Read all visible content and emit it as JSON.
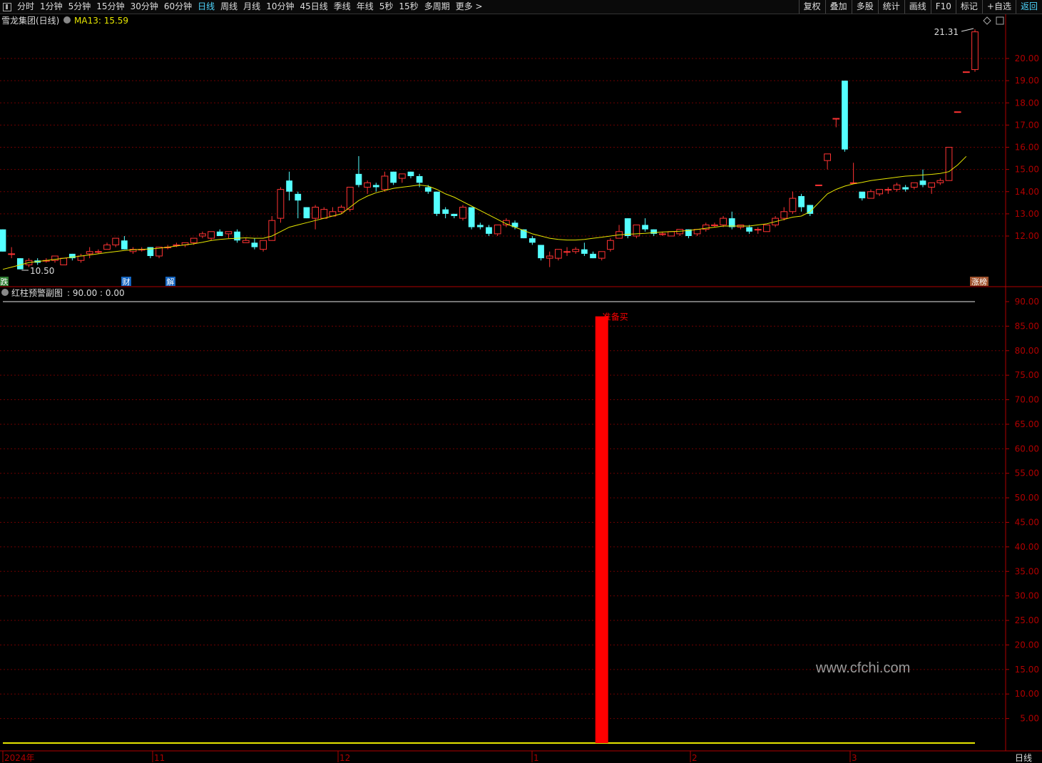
{
  "toolbar": {
    "periods": [
      "分时",
      "1分钟",
      "5分钟",
      "15分钟",
      "30分钟",
      "60分钟",
      "日线",
      "周线",
      "月线",
      "10分钟",
      "45日线",
      "季线",
      "年线",
      "5秒",
      "15秒",
      "多周期",
      "更多 >"
    ],
    "active_period": "日线",
    "right_buttons": [
      "复权",
      "叠加",
      "多股",
      "统计",
      "画线",
      "F10",
      "标记",
      "+自选",
      "返回"
    ]
  },
  "main_panel": {
    "stock_title": "雪龙集团(日线)",
    "ma_label": "MA13: 15.59",
    "high_marker": "21.31",
    "low_marker": "10.50",
    "y_ticks": [
      "20.00",
      "19.00",
      "18.00",
      "17.00",
      "16.00",
      "15.00",
      "14.00",
      "13.00",
      "12.00"
    ],
    "event_badges": [
      {
        "label": "跌",
        "color": "#2e7d32"
      },
      {
        "label": "财",
        "color": "#1565c0"
      },
      {
        "label": "解",
        "color": "#1565c0"
      },
      {
        "label": "涨榜",
        "color": "#a0522d"
      }
    ]
  },
  "sub_panel": {
    "title": "红柱预警副图",
    "values": ": 90.00 : 0.00",
    "signal_label": "准备买",
    "y_ticks": [
      "90.00",
      "85.00",
      "80.00",
      "75.00",
      "70.00",
      "65.00",
      "60.00",
      "55.00",
      "50.00",
      "45.00",
      "40.00",
      "35.00",
      "30.00",
      "25.00",
      "20.00",
      "15.00",
      "10.00",
      "5.00"
    ]
  },
  "x_axis": {
    "labels": [
      "2024年",
      "11",
      "12",
      "1",
      "2",
      "3"
    ],
    "period_label": "日线"
  },
  "watermark": "www.cfchi.com",
  "colors": {
    "up": "#ff3333",
    "down": "#54ffff",
    "ma": "#e6e600",
    "grid": "#6e0000",
    "axis": "#b00000",
    "signal_bar": "#ff0000",
    "accent": "#4fd7ff"
  },
  "chart_data": {
    "type": "candlestick",
    "ylim": [
      10.0,
      21.5
    ],
    "candles": [
      {
        "o": 12.3,
        "c": 11.3,
        "h": 12.3,
        "l": 11.3
      },
      {
        "o": 11.2,
        "c": 11.2,
        "h": 11.5,
        "l": 11.0
      },
      {
        "o": 11.0,
        "c": 10.5,
        "h": 11.0,
        "l": 10.5
      },
      {
        "o": 10.7,
        "c": 10.9,
        "h": 11.0,
        "l": 10.6
      },
      {
        "o": 10.9,
        "c": 10.8,
        "h": 11.0,
        "l": 10.7
      },
      {
        "o": 10.9,
        "c": 10.9,
        "h": 11.0,
        "l": 10.8
      },
      {
        "o": 10.9,
        "c": 11.1,
        "h": 11.1,
        "l": 10.8
      },
      {
        "o": 10.7,
        "c": 11.0,
        "h": 11.0,
        "l": 10.7
      },
      {
        "o": 11.2,
        "c": 11.0,
        "h": 11.2,
        "l": 10.9
      },
      {
        "o": 10.9,
        "c": 11.1,
        "h": 11.2,
        "l": 10.8
      },
      {
        "o": 11.2,
        "c": 11.3,
        "h": 11.5,
        "l": 11.0
      },
      {
        "o": 11.3,
        "c": 11.3,
        "h": 11.4,
        "l": 11.2
      },
      {
        "o": 11.4,
        "c": 11.6,
        "h": 11.7,
        "l": 11.4
      },
      {
        "o": 11.6,
        "c": 11.9,
        "h": 11.9,
        "l": 11.5
      },
      {
        "o": 11.8,
        "c": 11.4,
        "h": 12.0,
        "l": 11.4
      },
      {
        "o": 11.3,
        "c": 11.4,
        "h": 11.5,
        "l": 11.2
      },
      {
        "o": 11.4,
        "c": 11.4,
        "h": 11.5,
        "l": 11.3
      },
      {
        "o": 11.5,
        "c": 11.1,
        "h": 11.5,
        "l": 11.0
      },
      {
        "o": 11.1,
        "c": 11.5,
        "h": 11.5,
        "l": 11.0
      },
      {
        "o": 11.5,
        "c": 11.5,
        "h": 11.6,
        "l": 11.4
      },
      {
        "o": 11.6,
        "c": 11.6,
        "h": 11.7,
        "l": 11.5
      },
      {
        "o": 11.6,
        "c": 11.7,
        "h": 11.7,
        "l": 11.5
      },
      {
        "o": 11.7,
        "c": 11.9,
        "h": 11.9,
        "l": 11.6
      },
      {
        "o": 12.0,
        "c": 12.1,
        "h": 12.2,
        "l": 11.9
      },
      {
        "o": 11.9,
        "c": 12.2,
        "h": 12.2,
        "l": 11.8
      },
      {
        "o": 12.2,
        "c": 12.0,
        "h": 12.3,
        "l": 12.0
      },
      {
        "o": 12.1,
        "c": 12.2,
        "h": 12.2,
        "l": 11.9
      },
      {
        "o": 12.2,
        "c": 11.8,
        "h": 12.3,
        "l": 11.7
      },
      {
        "o": 11.7,
        "c": 11.8,
        "h": 11.9,
        "l": 11.7
      },
      {
        "o": 11.7,
        "c": 11.5,
        "h": 11.9,
        "l": 11.4
      },
      {
        "o": 11.4,
        "c": 11.8,
        "h": 11.8,
        "l": 11.3
      },
      {
        "o": 11.8,
        "c": 12.7,
        "h": 12.9,
        "l": 11.8
      },
      {
        "o": 12.8,
        "c": 14.1,
        "h": 14.2,
        "l": 12.6
      },
      {
        "o": 14.5,
        "c": 14.0,
        "h": 14.9,
        "l": 13.6
      },
      {
        "o": 13.9,
        "c": 13.6,
        "h": 14.0,
        "l": 12.8
      },
      {
        "o": 13.3,
        "c": 12.8,
        "h": 13.3,
        "l": 12.8
      },
      {
        "o": 12.8,
        "c": 13.3,
        "h": 13.4,
        "l": 12.3
      },
      {
        "o": 12.8,
        "c": 13.2,
        "h": 13.3,
        "l": 12.8
      },
      {
        "o": 12.9,
        "c": 13.1,
        "h": 13.3,
        "l": 12.9
      },
      {
        "o": 13.1,
        "c": 13.3,
        "h": 13.4,
        "l": 13.0
      },
      {
        "o": 13.2,
        "c": 14.2,
        "h": 14.2,
        "l": 13.1
      },
      {
        "o": 14.8,
        "c": 14.3,
        "h": 15.6,
        "l": 14.2
      },
      {
        "o": 14.2,
        "c": 14.4,
        "h": 14.5,
        "l": 13.9
      },
      {
        "o": 14.3,
        "c": 14.2,
        "h": 14.4,
        "l": 14.0
      },
      {
        "o": 14.1,
        "c": 14.7,
        "h": 14.9,
        "l": 14.0
      },
      {
        "o": 14.9,
        "c": 14.4,
        "h": 14.9,
        "l": 14.3
      },
      {
        "o": 14.6,
        "c": 14.8,
        "h": 14.8,
        "l": 14.4
      },
      {
        "o": 14.9,
        "c": 14.7,
        "h": 14.9,
        "l": 14.6
      },
      {
        "o": 14.7,
        "c": 14.4,
        "h": 14.8,
        "l": 14.2
      },
      {
        "o": 14.2,
        "c": 14.0,
        "h": 14.3,
        "l": 13.9
      },
      {
        "o": 14.0,
        "c": 13.0,
        "h": 14.0,
        "l": 12.9
      },
      {
        "o": 13.2,
        "c": 13.0,
        "h": 13.3,
        "l": 12.8
      },
      {
        "o": 13.0,
        "c": 12.9,
        "h": 13.0,
        "l": 12.8
      },
      {
        "o": 12.8,
        "c": 13.3,
        "h": 13.4,
        "l": 12.7
      },
      {
        "o": 13.3,
        "c": 12.4,
        "h": 13.3,
        "l": 12.3
      },
      {
        "o": 12.5,
        "c": 12.4,
        "h": 12.6,
        "l": 12.3
      },
      {
        "o": 12.4,
        "c": 12.1,
        "h": 12.5,
        "l": 12.0
      },
      {
        "o": 12.1,
        "c": 12.5,
        "h": 12.5,
        "l": 12.0
      },
      {
        "o": 12.5,
        "c": 12.7,
        "h": 12.8,
        "l": 12.4
      },
      {
        "o": 12.6,
        "c": 12.4,
        "h": 12.7,
        "l": 12.3
      },
      {
        "o": 12.3,
        "c": 11.9,
        "h": 12.3,
        "l": 11.9
      },
      {
        "o": 11.9,
        "c": 11.7,
        "h": 12.0,
        "l": 11.6
      },
      {
        "o": 11.6,
        "c": 11.0,
        "h": 11.6,
        "l": 10.9
      },
      {
        "o": 11.0,
        "c": 11.1,
        "h": 11.3,
        "l": 10.6
      },
      {
        "o": 11.0,
        "c": 11.4,
        "h": 11.4,
        "l": 10.9
      },
      {
        "o": 11.3,
        "c": 11.3,
        "h": 11.5,
        "l": 11.1
      },
      {
        "o": 11.3,
        "c": 11.4,
        "h": 11.5,
        "l": 11.2
      },
      {
        "o": 11.4,
        "c": 11.2,
        "h": 11.7,
        "l": 11.1
      },
      {
        "o": 11.2,
        "c": 11.0,
        "h": 11.3,
        "l": 11.0
      },
      {
        "o": 11.0,
        "c": 11.3,
        "h": 11.3,
        "l": 10.9
      },
      {
        "o": 11.4,
        "c": 11.8,
        "h": 11.9,
        "l": 11.3
      },
      {
        "o": 11.9,
        "c": 12.2,
        "h": 12.5,
        "l": 11.9
      },
      {
        "o": 12.8,
        "c": 12.0,
        "h": 12.8,
        "l": 11.9
      },
      {
        "o": 12.0,
        "c": 12.5,
        "h": 12.5,
        "l": 11.9
      },
      {
        "o": 12.5,
        "c": 12.3,
        "h": 12.8,
        "l": 12.2
      },
      {
        "o": 12.3,
        "c": 12.1,
        "h": 12.3,
        "l": 12.0
      },
      {
        "o": 12.1,
        "c": 12.1,
        "h": 12.2,
        "l": 12.0
      },
      {
        "o": 12.0,
        "c": 12.2,
        "h": 12.2,
        "l": 12.0
      },
      {
        "o": 12.1,
        "c": 12.3,
        "h": 12.3,
        "l": 12.0
      },
      {
        "o": 12.3,
        "c": 12.0,
        "h": 12.3,
        "l": 11.9
      },
      {
        "o": 12.1,
        "c": 12.3,
        "h": 12.3,
        "l": 12.0
      },
      {
        "o": 12.3,
        "c": 12.5,
        "h": 12.6,
        "l": 12.2
      },
      {
        "o": 12.5,
        "c": 12.5,
        "h": 12.6,
        "l": 12.4
      },
      {
        "o": 12.5,
        "c": 12.8,
        "h": 12.9,
        "l": 12.4
      },
      {
        "o": 12.8,
        "c": 12.4,
        "h": 13.1,
        "l": 12.3
      },
      {
        "o": 12.4,
        "c": 12.5,
        "h": 12.5,
        "l": 12.3
      },
      {
        "o": 12.4,
        "c": 12.2,
        "h": 12.5,
        "l": 12.1
      },
      {
        "o": 12.3,
        "c": 12.3,
        "h": 12.4,
        "l": 12.1
      },
      {
        "o": 12.2,
        "c": 12.5,
        "h": 12.5,
        "l": 12.2
      },
      {
        "o": 12.5,
        "c": 12.8,
        "h": 12.9,
        "l": 12.4
      },
      {
        "o": 12.8,
        "c": 13.1,
        "h": 13.3,
        "l": 12.7
      },
      {
        "o": 13.1,
        "c": 13.7,
        "h": 14.0,
        "l": 13.0
      },
      {
        "o": 13.8,
        "c": 13.3,
        "h": 13.9,
        "l": 13.1
      },
      {
        "o": 13.4,
        "c": 13.0,
        "h": 13.4,
        "l": 12.9
      },
      {
        "o": 14.3,
        "c": 14.3,
        "h": 14.3,
        "l": 14.3
      },
      {
        "o": 15.4,
        "c": 15.7,
        "h": 15.7,
        "l": 15.0
      },
      {
        "o": 17.3,
        "c": 17.3,
        "h": 17.3,
        "l": 16.9
      },
      {
        "o": 19.0,
        "c": 15.9,
        "h": 19.0,
        "l": 15.8
      },
      {
        "o": 14.4,
        "c": 14.4,
        "h": 15.3,
        "l": 14.4
      },
      {
        "o": 14.0,
        "c": 13.7,
        "h": 14.0,
        "l": 13.6
      },
      {
        "o": 13.7,
        "c": 14.0,
        "h": 14.1,
        "l": 13.7
      },
      {
        "o": 13.9,
        "c": 14.1,
        "h": 14.1,
        "l": 13.8
      },
      {
        "o": 14.1,
        "c": 14.1,
        "h": 14.2,
        "l": 13.9
      },
      {
        "o": 14.1,
        "c": 14.3,
        "h": 14.4,
        "l": 14.0
      },
      {
        "o": 14.2,
        "c": 14.1,
        "h": 14.3,
        "l": 14.0
      },
      {
        "o": 14.2,
        "c": 14.4,
        "h": 14.4,
        "l": 14.1
      },
      {
        "o": 14.5,
        "c": 14.3,
        "h": 15.0,
        "l": 14.2
      },
      {
        "o": 14.2,
        "c": 14.4,
        "h": 14.4,
        "l": 13.9
      },
      {
        "o": 14.4,
        "c": 14.5,
        "h": 14.6,
        "l": 14.3
      },
      {
        "o": 14.5,
        "c": 16.0,
        "h": 16.0,
        "l": 14.5
      },
      {
        "o": 17.6,
        "c": 17.6,
        "h": 17.6,
        "l": 17.6
      },
      {
        "o": 19.4,
        "c": 19.4,
        "h": 19.4,
        "l": 19.4
      },
      {
        "o": 19.5,
        "c": 21.2,
        "h": 21.31,
        "l": 19.4
      }
    ],
    "ma": [
      10.5,
      10.6,
      10.7,
      10.8,
      10.85,
      10.9,
      10.95,
      11.0,
      11.05,
      11.1,
      11.15,
      11.2,
      11.25,
      11.3,
      11.35,
      11.38,
      11.4,
      11.42,
      11.45,
      11.5,
      11.55,
      11.6,
      11.65,
      11.72,
      11.8,
      11.85,
      11.88,
      11.9,
      11.92,
      11.9,
      11.9,
      12.0,
      12.2,
      12.4,
      12.5,
      12.6,
      12.7,
      12.8,
      12.9,
      13.0,
      13.3,
      13.6,
      13.8,
      13.95,
      14.05,
      14.15,
      14.2,
      14.25,
      14.3,
      14.25,
      14.1,
      13.9,
      13.75,
      13.55,
      13.35,
      13.15,
      12.95,
      12.75,
      12.55,
      12.4,
      12.25,
      12.1,
      12.0,
      11.9,
      11.85,
      11.82,
      11.82,
      11.85,
      11.9,
      11.95,
      12.0,
      12.05,
      12.08,
      12.1,
      12.12,
      12.15,
      12.18,
      12.2,
      12.22,
      12.25,
      12.3,
      12.35,
      12.4,
      12.45,
      12.45,
      12.45,
      12.45,
      12.5,
      12.55,
      12.65,
      12.75,
      12.85,
      12.9,
      13.1,
      13.5,
      13.9,
      14.1,
      14.25,
      14.35,
      14.42,
      14.5,
      14.55,
      14.6,
      14.65,
      14.7,
      14.72,
      14.75,
      14.78,
      14.82,
      14.9,
      15.2,
      15.59
    ],
    "signal": {
      "index": 69,
      "value": 87,
      "label": "准备买"
    },
    "sub_ylim": [
      0,
      92
    ]
  }
}
